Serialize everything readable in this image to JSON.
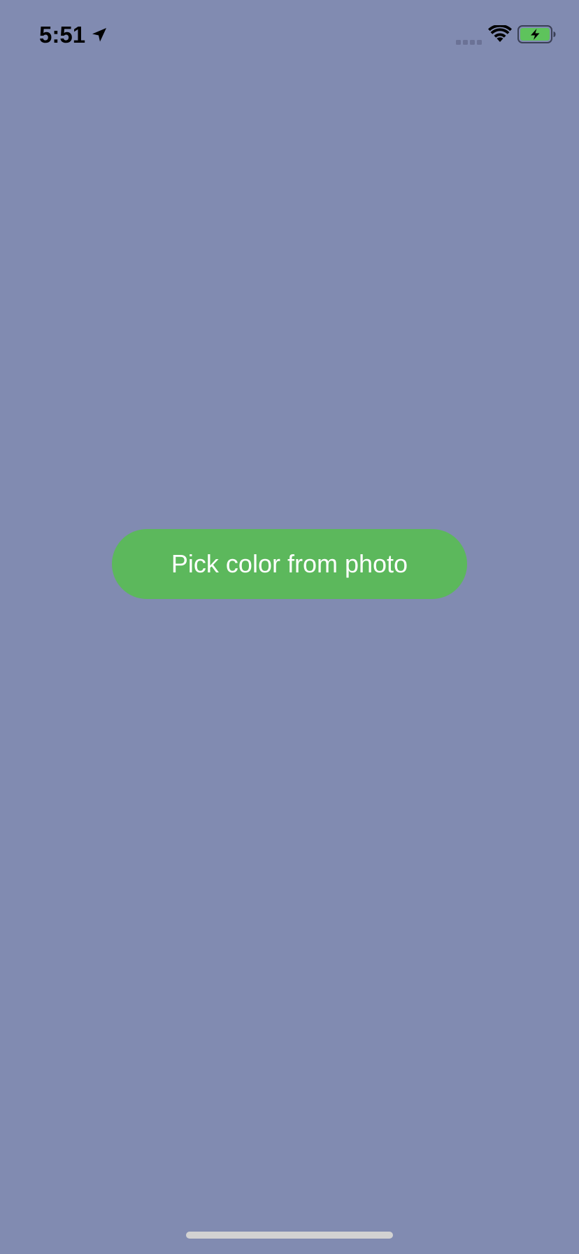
{
  "status_bar": {
    "time": "5:51",
    "icons": {
      "location": "location-arrow-icon",
      "signal": "cellular-signal-icon",
      "wifi": "wifi-icon",
      "battery": "battery-charging-icon"
    }
  },
  "main": {
    "pick_button_label": "Pick color from photo"
  },
  "colors": {
    "background": "#818bb1",
    "button": "#5cb85c",
    "button_text": "#ffffff",
    "battery_fill": "#5ec35c",
    "home_indicator": "#d2d2d2"
  }
}
